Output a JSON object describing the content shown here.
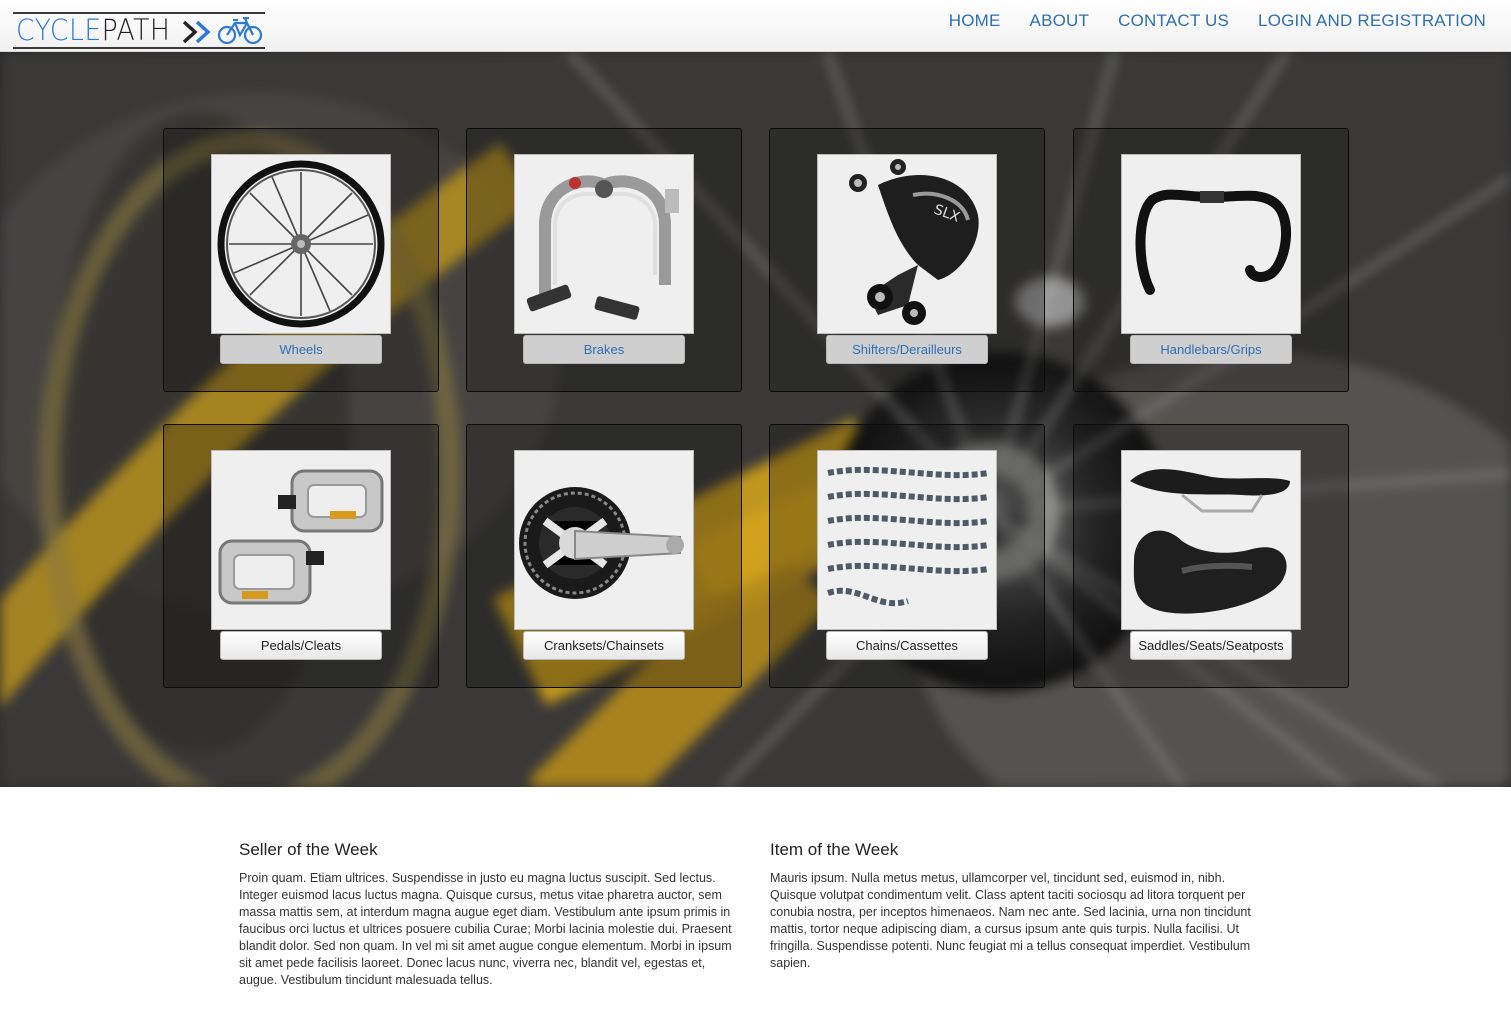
{
  "brand": {
    "name_part1": "CYCLE",
    "name_part2": "PATH",
    "accent_color": "#2d7ad6",
    "icon": "bicycle-icon"
  },
  "nav": {
    "items": [
      "HOME",
      "ABOUT",
      "CONTACT US",
      "LOGIN AND REGISTRATION"
    ],
    "color": "#2f6fb3"
  },
  "categories": [
    {
      "label": "Wheels",
      "icon": "wheel-icon"
    },
    {
      "label": "Brakes",
      "icon": "brake-icon"
    },
    {
      "label": "Shifters/Derailleurs",
      "icon": "derailleur-icon"
    },
    {
      "label": "Handlebars/Grips",
      "icon": "handlebar-icon"
    },
    {
      "label": "Pedals/Cleats",
      "icon": "pedal-icon"
    },
    {
      "label": "Cranksets/Chainsets",
      "icon": "crankset-icon"
    },
    {
      "label": "Chains/Cassettes",
      "icon": "chain-icon"
    },
    {
      "label": "Saddles/Seats/Seatposts",
      "icon": "saddle-icon"
    }
  ],
  "seller": {
    "title": "Seller of the Week",
    "body": "Proin quam. Etiam ultrices. Suspendisse in justo eu magna luctus suscipit. Sed lectus. Integer euismod lacus luctus magna. Quisque cursus, metus vitae pharetra auctor, sem massa mattis sem, at interdum magna augue eget diam. Vestibulum ante ipsum primis in faucibus orci luctus et ultrices posuere cubilia Curae; Morbi lacinia molestie dui. Praesent blandit dolor. Sed non quam. In vel mi sit amet augue congue elementum. Morbi in ipsum sit amet pede facilisis laoreet. Donec lacus nunc, viverra nec, blandit vel, egestas et, augue. Vestibulum tincidunt malesuada tellus."
  },
  "item": {
    "title": "Item of the Week",
    "body": "Mauris ipsum. Nulla metus metus, ullamcorper vel, tincidunt sed, euismod in, nibh. Quisque volutpat condimentum velit. Class aptent taciti sociosqu ad litora torquent per conubia nostra, per inceptos himenaeos. Nam nec ante. Sed lacinia, urna non tincidunt mattis, tortor neque adipiscing diam, a cursus ipsum ante quis turpis. Nulla facilisi. Ut fringilla. Suspendisse potenti. Nunc feugiat mi a tellus consequat imperdiet. Vestibulum sapien."
  }
}
